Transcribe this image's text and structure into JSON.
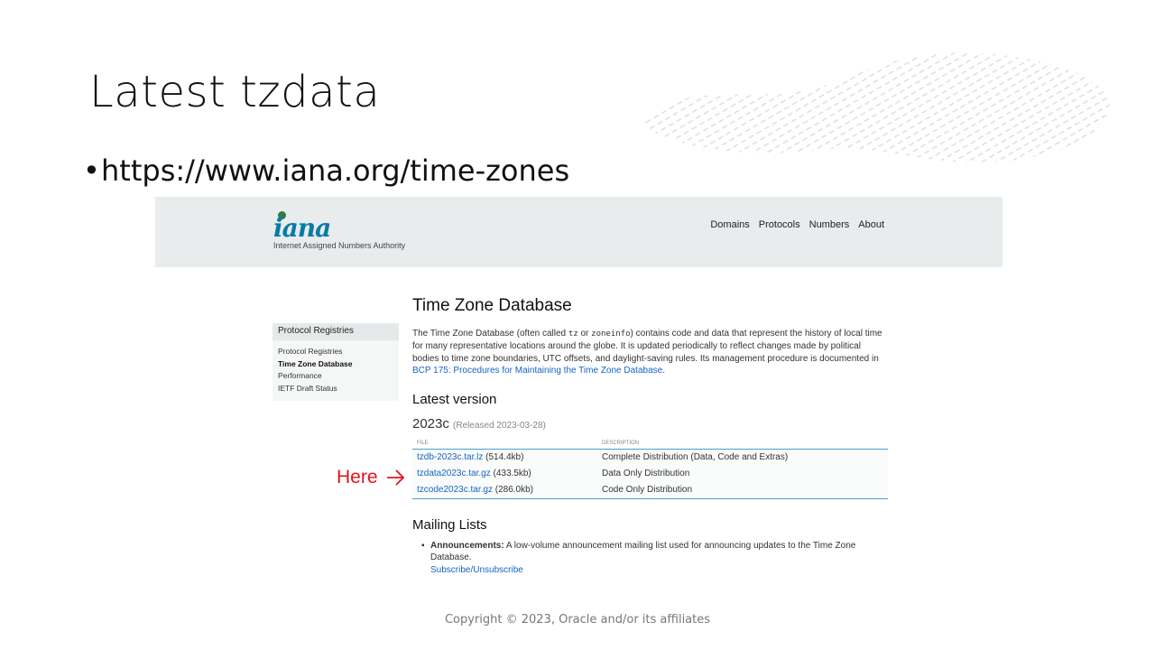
{
  "slide": {
    "title": "Latest tzdata",
    "bullet": "https://www.iana.org/time-zones",
    "annotation": "Here",
    "footer": "Copyright © 2023, Oracle and/or its affiliates"
  },
  "iana": {
    "logo_text": "iana",
    "logo_subtitle": "Internet Assigned Numbers Authority",
    "nav": [
      "Domains",
      "Protocols",
      "Numbers",
      "About"
    ],
    "sidebar": {
      "heading": "Protocol Registries",
      "items": [
        "Protocol Registries",
        "Time Zone Database",
        "Performance",
        "IETF Draft Status"
      ],
      "active": "Time Zone Database"
    },
    "page_title": "Time Zone Database",
    "intro": {
      "part1": "The Time Zone Database (often called ",
      "code1": "tz",
      "part2": " or ",
      "code2": "zoneinfo",
      "part3": ") contains code and data that represent the history of local time for many representative locations around the globe. It is updated periodically to reflect changes made by political bodies to time zone boundaries, UTC offsets, and daylight-saving rules. Its management procedure is documented in ",
      "link": "BCP 175: Procedures for Maintaining the Time Zone Database",
      "part4": "."
    },
    "latest_heading": "Latest version",
    "version": "2023c",
    "released": "(Released 2023-03-28)",
    "table": {
      "headers": [
        "FILE",
        "DESCRIPTION"
      ],
      "rows": [
        {
          "file": "tzdb-2023c.tar.lz",
          "size": "(514.4kb)",
          "desc": "Complete Distribution (Data, Code and Extras)"
        },
        {
          "file": "tzdata2023c.tar.gz",
          "size": "(433.5kb)",
          "desc": "Data Only Distribution"
        },
        {
          "file": "tzcode2023c.tar.gz",
          "size": "(286.0kb)",
          "desc": "Code Only Distribution"
        }
      ]
    },
    "mailing_heading": "Mailing Lists",
    "mailing": {
      "label": "Announcements:",
      "text": " A low-volume announcement mailing list used for announcing updates to the Time Zone Database.",
      "link": "Subscribe/Unsubscribe"
    }
  },
  "colors": {
    "link": "#1565c0",
    "annotation": "#e0141e",
    "header_bg": "#e8ecec",
    "table_rule": "#4a9fd0"
  }
}
